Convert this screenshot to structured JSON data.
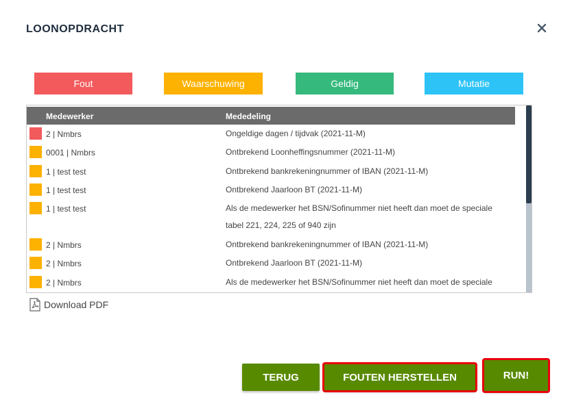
{
  "dialog": {
    "title": "LOONOPDRACHT",
    "close_icon": "close-icon"
  },
  "legend": {
    "fout": "Fout",
    "waarschuwing": "Waarschuwing",
    "geldig": "Geldig",
    "mutatie": "Mutatie"
  },
  "colors": {
    "fout": "#f25a5c",
    "waarschuwing": "#fdb100",
    "geldig": "#35b97c",
    "mutatie": "#2dc3f7",
    "button": "#588a00",
    "highlight": "#e8000b"
  },
  "table": {
    "headers": {
      "medewerker": "Medewerker",
      "mededeling": "Mededeling"
    },
    "rows": [
      {
        "status": "fout",
        "medewerker": "2 | Nmbrs",
        "mededeling": "Ongeldige dagen / tijdvak (2021-11-M)"
      },
      {
        "status": "waarschuwing",
        "medewerker": "0001 | Nmbrs",
        "mededeling": "Ontbrekend Loonheffingsnummer (2021-11-M)"
      },
      {
        "status": "waarschuwing",
        "medewerker": "1 | test test",
        "mededeling": "Ontbrekend bankrekeningnummer of IBAN (2021-11-M)"
      },
      {
        "status": "waarschuwing",
        "medewerker": "1 | test test",
        "mededeling": "Ontbrekend Jaarloon BT (2021-11-M)"
      },
      {
        "status": "waarschuwing",
        "medewerker": "1 | test test",
        "mededeling": "Als de medewerker het BSN/Sofinummer niet heeft dan moet de speciale tabel 221, 224, 225 of 940 zijn"
      },
      {
        "status": "waarschuwing",
        "medewerker": "2 | Nmbrs",
        "mededeling": "Ontbrekend bankrekeningnummer of IBAN (2021-11-M)"
      },
      {
        "status": "waarschuwing",
        "medewerker": "2 | Nmbrs",
        "mededeling": "Ontbrekend Jaarloon BT (2021-11-M)"
      },
      {
        "status": "waarschuwing",
        "medewerker": "2 | Nmbrs",
        "mededeling": "Als de medewerker het BSN/Sofinummer niet heeft dan moet de speciale"
      }
    ]
  },
  "download": {
    "label": "Download PDF",
    "icon": "pdf-icon"
  },
  "buttons": {
    "terug": "TERUG",
    "fouten_herstellen": "FOUTEN HERSTELLEN",
    "run": "RUN!"
  }
}
